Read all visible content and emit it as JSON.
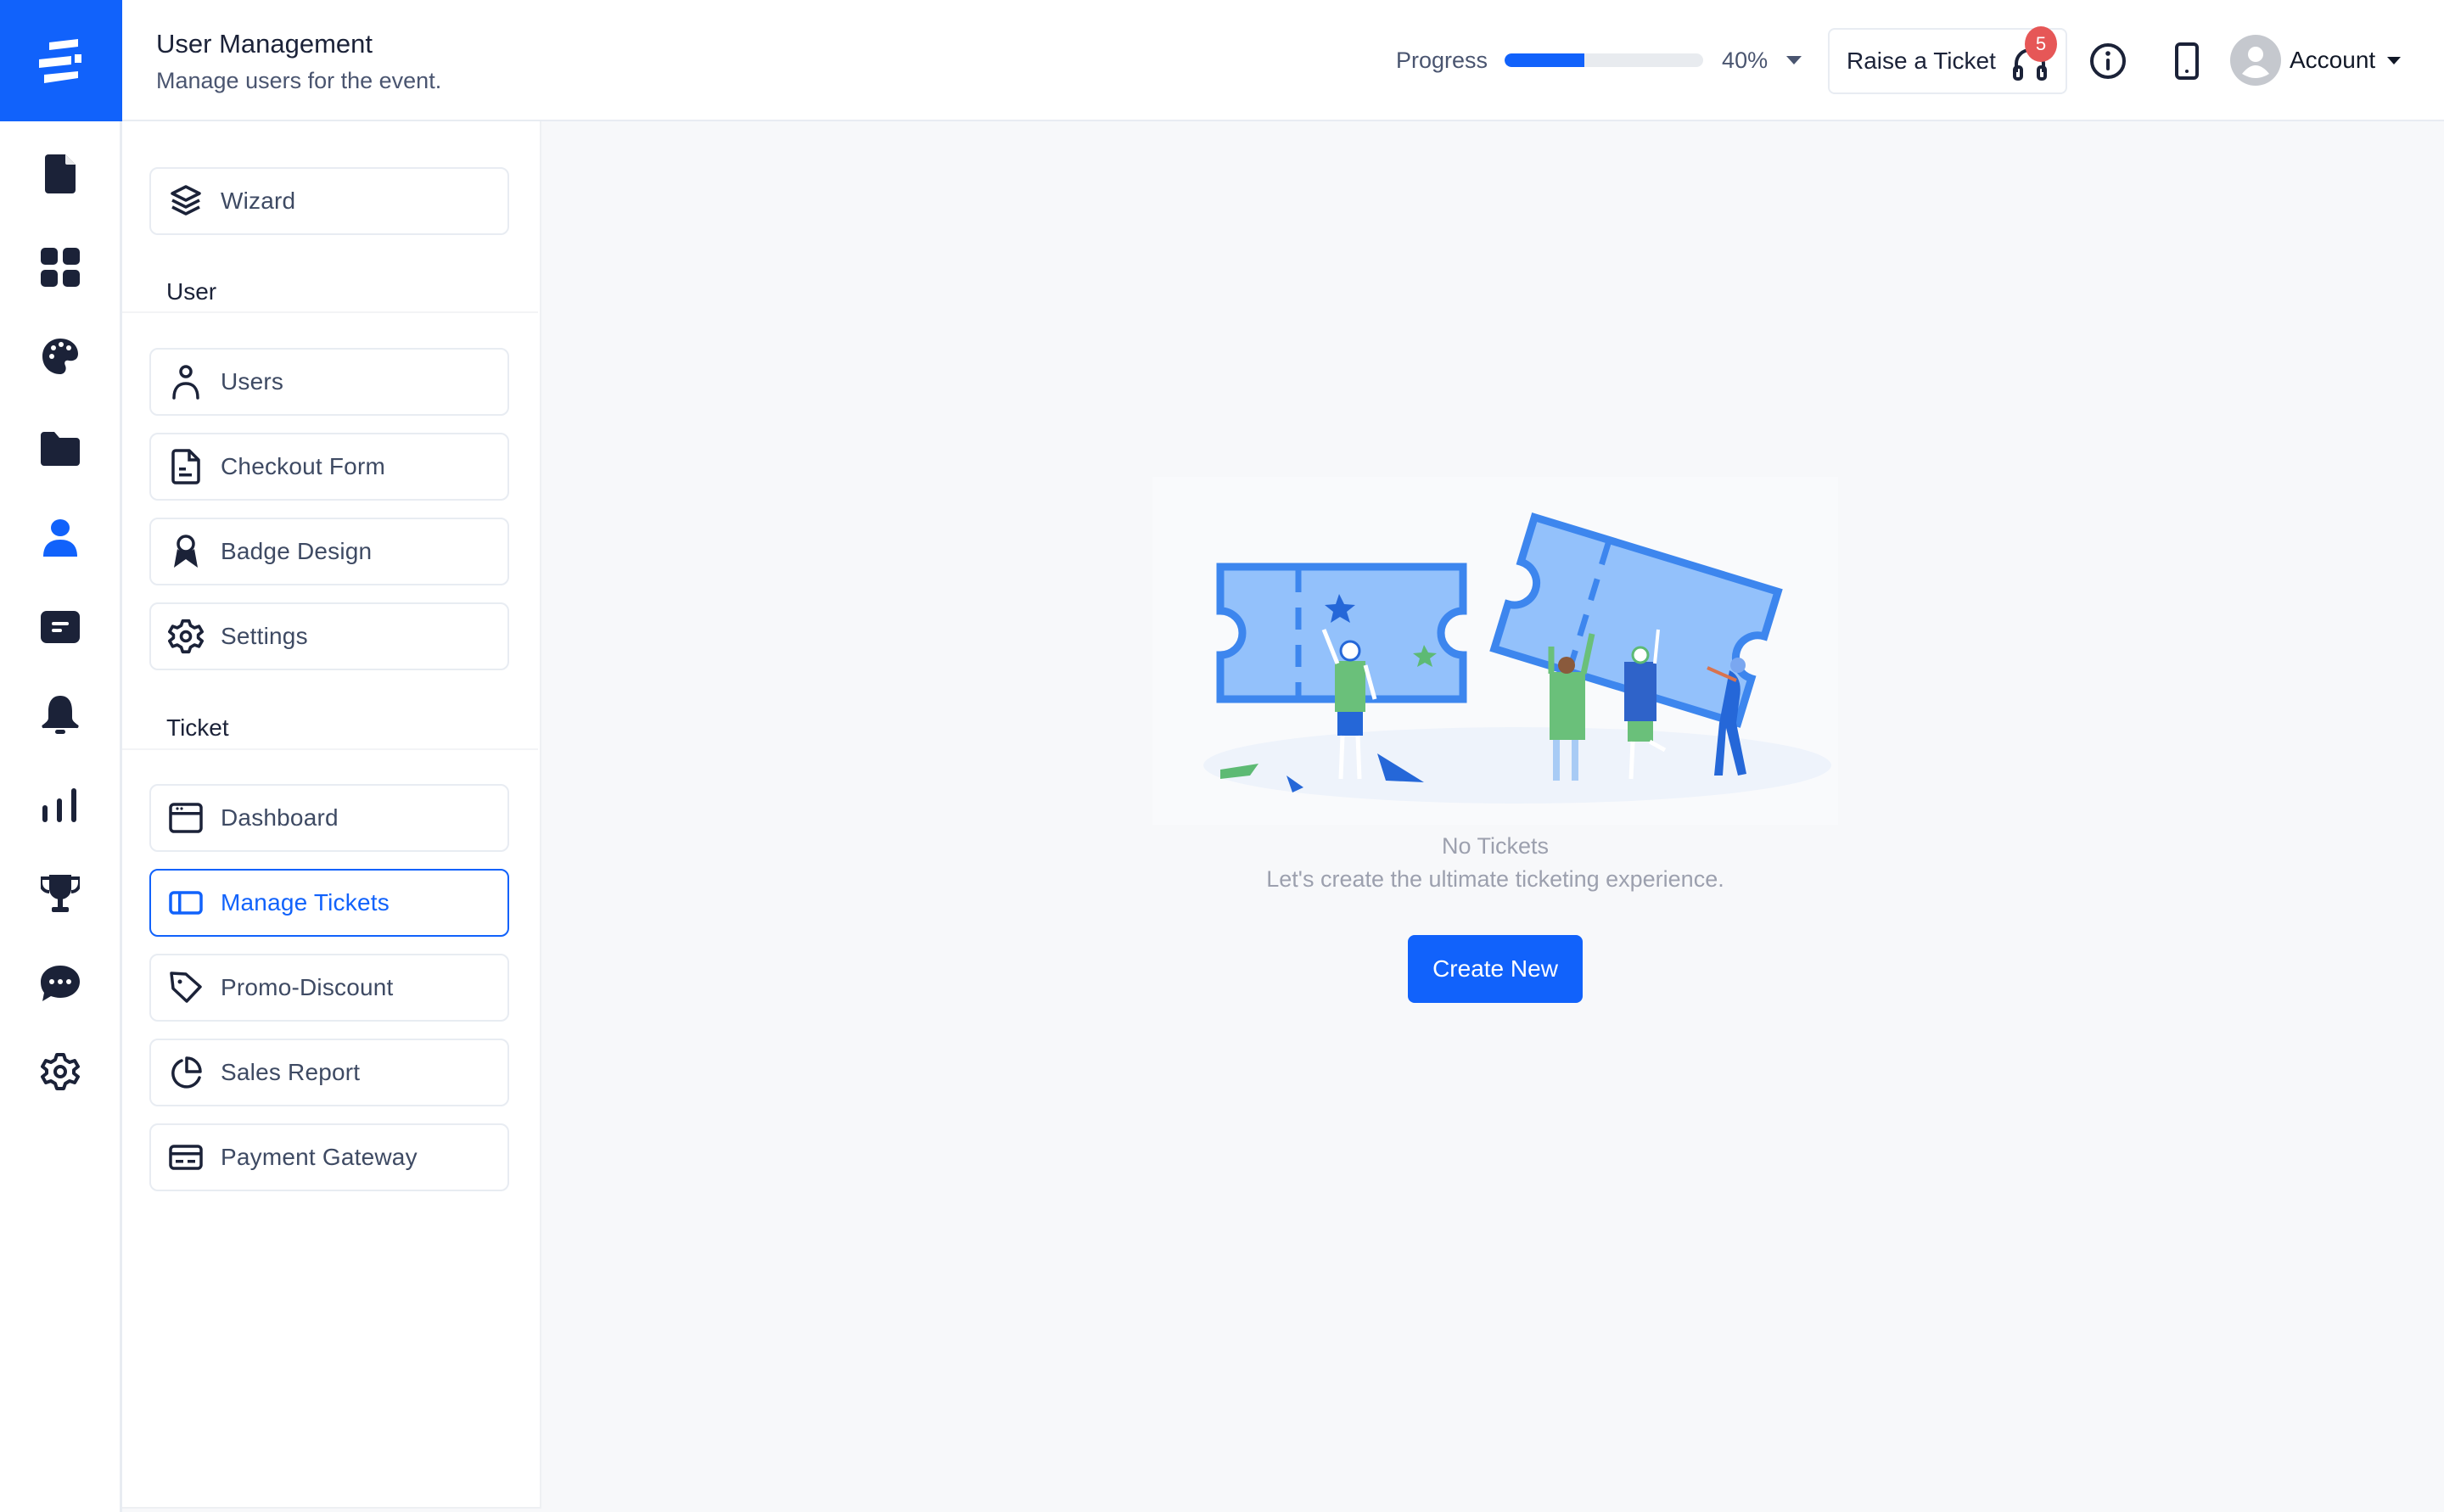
{
  "header": {
    "title": "User Management",
    "subtitle": "Manage users for the event.",
    "progress": {
      "label": "Progress",
      "percent": 40,
      "value_text": "40%"
    },
    "raise_ticket": {
      "label": "Raise a Ticket",
      "badge_count": "5"
    },
    "account_label": "Account"
  },
  "rail": {
    "items": [
      {
        "icon": "document-icon"
      },
      {
        "icon": "grid-icon"
      },
      {
        "icon": "palette-icon"
      },
      {
        "icon": "folder-icon"
      },
      {
        "icon": "user-icon",
        "active": true
      },
      {
        "icon": "card-icon"
      },
      {
        "icon": "bell-icon"
      },
      {
        "icon": "bar-chart-icon"
      },
      {
        "icon": "trophy-icon"
      },
      {
        "icon": "chat-icon"
      },
      {
        "icon": "gear-icon"
      }
    ]
  },
  "subnav": {
    "wizard": "Wizard",
    "sections": [
      {
        "title": "User",
        "items": [
          {
            "label": "Users",
            "icon": "user-outline-icon"
          },
          {
            "label": "Checkout Form",
            "icon": "file-icon"
          },
          {
            "label": "Badge Design",
            "icon": "ribbon-icon"
          },
          {
            "label": "Settings",
            "icon": "gear-icon"
          }
        ]
      },
      {
        "title": "Ticket",
        "items": [
          {
            "label": "Dashboard",
            "icon": "browser-window-icon"
          },
          {
            "label": "Manage Tickets",
            "icon": "sidebar-layout-icon",
            "active": true
          },
          {
            "label": "Promo-Discount",
            "icon": "tag-icon"
          },
          {
            "label": "Sales Report",
            "icon": "pie-chart-icon"
          },
          {
            "label": "Payment Gateway",
            "icon": "credit-card-icon"
          }
        ]
      }
    ]
  },
  "main": {
    "empty_title": "No Tickets",
    "empty_subtitle": "Let's create the ultimate ticketing experience.",
    "create_button": "Create New"
  },
  "colors": {
    "accent": "#1162FB",
    "badge": "#E65757",
    "icon_dark": "#1B2238",
    "muted_text": "#9CA0AE"
  }
}
